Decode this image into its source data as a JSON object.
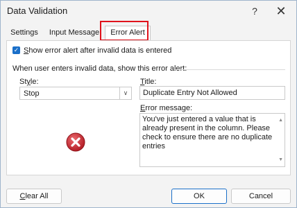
{
  "window": {
    "title": "Data Validation",
    "help_glyph": "?",
    "close_glyph": "✕"
  },
  "tabs": [
    {
      "label": "Settings"
    },
    {
      "label": "Input Message"
    },
    {
      "label": "Error Alert",
      "active": true
    }
  ],
  "error_alert": {
    "show_alert_checked": true,
    "show_alert_label_u": "S",
    "show_alert_label_rest": "how error alert after invalid data is entered",
    "section_label": "When user enters invalid data, show this error alert:",
    "style_label_pre": "St",
    "style_label_u": "y",
    "style_label_post": "le:",
    "style_value": "Stop",
    "title_label_u": "T",
    "title_label_rest": "itle:",
    "title_value": "Duplicate Entry Not Allowed",
    "message_label_u": "E",
    "message_label_rest": "rror message:",
    "message_value": "You've just entered a value that is already present in the column. Please check to ensure there are no duplicate entries",
    "icon": "stop-error-icon"
  },
  "buttons": {
    "clear_all_u": "C",
    "clear_all_rest": "lear All",
    "ok": "OK",
    "cancel": "Cancel"
  },
  "colors": {
    "accent": "#1a6fc9",
    "highlight": "#e0121b",
    "error_icon": "#c4262e"
  }
}
